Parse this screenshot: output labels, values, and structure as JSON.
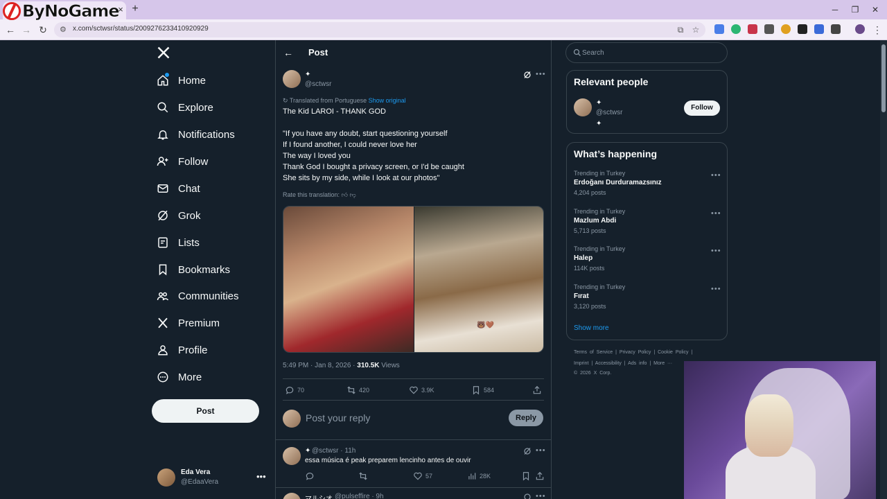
{
  "browser": {
    "logo_text": "ByNoGame",
    "url": "x.com/sctwsr/status/2009276233410920929",
    "tab_close": "×",
    "new_tab": "+"
  },
  "nav": {
    "items": [
      {
        "label": "Home"
      },
      {
        "label": "Explore"
      },
      {
        "label": "Notifications"
      },
      {
        "label": "Follow"
      },
      {
        "label": "Chat"
      },
      {
        "label": "Grok"
      },
      {
        "label": "Lists"
      },
      {
        "label": "Bookmarks"
      },
      {
        "label": "Communities"
      },
      {
        "label": "Premium"
      },
      {
        "label": "Profile"
      },
      {
        "label": "More"
      }
    ],
    "post_button": "Post",
    "account": {
      "name": "Eda Vera",
      "handle": "@EdaaVera",
      "more": "•••"
    }
  },
  "post": {
    "header_title": "Post",
    "author_name": "✦",
    "author_handle": "@sctwsr",
    "translated_label": "Translated from Portuguese",
    "show_original": "Show original",
    "lines": [
      "The Kid LAROI - THANK GOD",
      "\"If you have any doubt, start questioning yourself",
      "If I found another, I could never love her",
      "The way I loved you",
      "Thank God I bought a privacy screen, or I'd be caught",
      "She sits by my side, while I look at our photos\""
    ],
    "rate_translation": "Rate this translation:",
    "photo_caption": "🐻🤎",
    "time": "5:49 PM · Jan 8, 2026 · ",
    "views_count": "310.5K",
    "views_label": " Views",
    "stats": {
      "replies": "70",
      "reposts": "420",
      "likes": "3.9K",
      "bookmarks": "584"
    },
    "reply_placeholder": "Post your reply",
    "reply_button": "Reply"
  },
  "replies": [
    {
      "author": "✦",
      "handle": "@sctwsr · 11h",
      "text": "essa música é peak preparem lencinho antes de ouvir",
      "likes": "57",
      "views": "28K"
    },
    {
      "author": "マルシオ",
      "handle": "@pulseffire · 9h"
    }
  ],
  "search": {
    "placeholder": "Search"
  },
  "relevant_people": {
    "title": "Relevant people",
    "person": {
      "name": "✦",
      "handle": "@sctwsr",
      "bio": "✦",
      "follow": "Follow"
    }
  },
  "whats_happening": {
    "title": "What’s happening",
    "trends": [
      {
        "context": "Trending in Turkey",
        "name": "Erdoğanı Durduramazsınız",
        "count": "4,204 posts"
      },
      {
        "context": "Trending in Turkey",
        "name": "Mazlum Abdi",
        "count": "5,713 posts"
      },
      {
        "context": "Trending in Turkey",
        "name": "Halep",
        "count": "114K posts"
      },
      {
        "context": "Trending in Turkey",
        "name": "Fırat",
        "count": "3,120 posts"
      }
    ],
    "show_more": "Show more"
  },
  "footer": {
    "line1": "Terms of Service  |  Privacy Policy  |  Cookie Policy  |",
    "line2": "Imprint  |  Accessibility  |  Ads info  |  More ···",
    "line3": "© 2026 X Corp."
  },
  "colors": {
    "bg": "#15202b",
    "accent": "#1d9bf0",
    "border": "#38444d",
    "muted": "#8b98a5"
  }
}
